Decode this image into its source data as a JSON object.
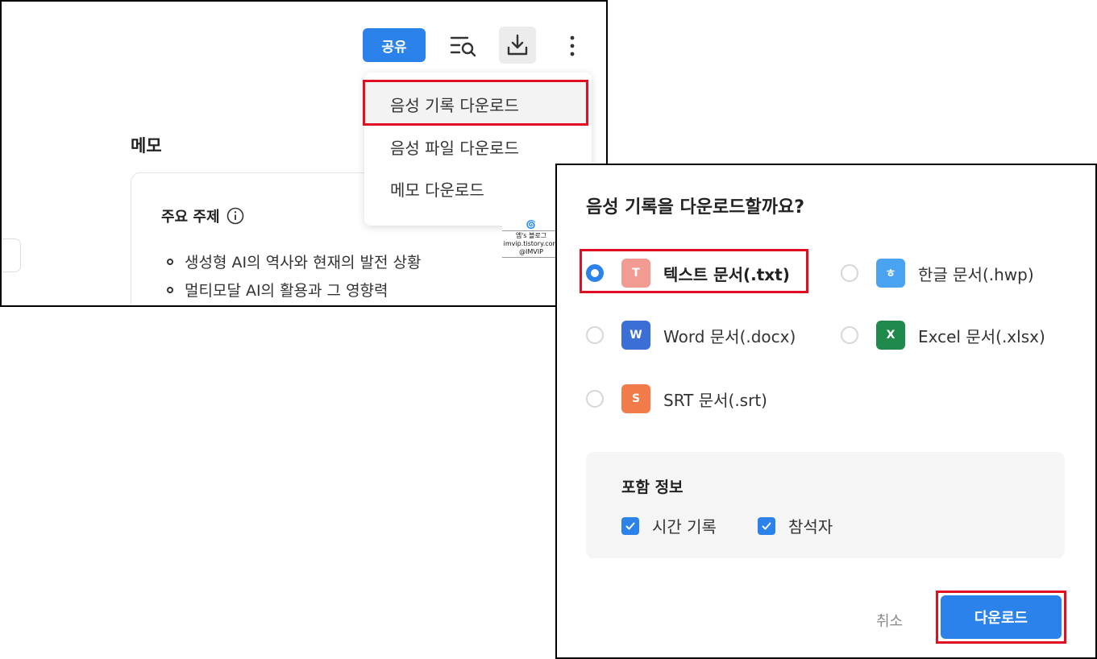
{
  "toolbar": {
    "share_label": "공유",
    "icons": [
      "search-list-icon",
      "download-icon",
      "more-vertical-icon"
    ]
  },
  "download_menu": {
    "items": [
      {
        "label": "음성 기록 다운로드"
      },
      {
        "label": "음성 파일 다운로드"
      },
      {
        "label": "메모 다운로드"
      }
    ]
  },
  "memo": {
    "title": "메모",
    "topic_title": "주요 주제",
    "bullets": [
      "생성형 AI의 역사와 현재의 발전 상황",
      "멀티모달 AI의 활용과 그 영향력"
    ]
  },
  "watermark": {
    "line1": "엠's 블로그",
    "line2": "imvip.tistory.com",
    "line3": "@IMVIP"
  },
  "dialog": {
    "title": "음성 기록을 다운로드할까요?",
    "options": [
      {
        "badge": "T",
        "label": "텍스트 문서(.txt)",
        "selected": true,
        "color": "#f29b93"
      },
      {
        "badge": "ㅎ",
        "label": "한글 문서(.hwp)",
        "selected": false,
        "color": "#4aa3f0"
      },
      {
        "badge": "W",
        "label": "Word 문서(.docx)",
        "selected": false,
        "color": "#3b6fd6"
      },
      {
        "badge": "X",
        "label": "Excel 문서(.xlsx)",
        "selected": false,
        "color": "#1f8a4c"
      },
      {
        "badge": "S",
        "label": "SRT 문서(.srt)",
        "selected": false,
        "color": "#f27b4a"
      }
    ],
    "include_info": {
      "title": "포함 정보",
      "checkboxes": [
        {
          "label": "시간 기록",
          "checked": true
        },
        {
          "label": "참석자",
          "checked": true
        }
      ]
    },
    "cancel_label": "취소",
    "download_label": "다운로드"
  },
  "colors": {
    "accent": "#2a82ea",
    "highlight": "#e01020"
  }
}
